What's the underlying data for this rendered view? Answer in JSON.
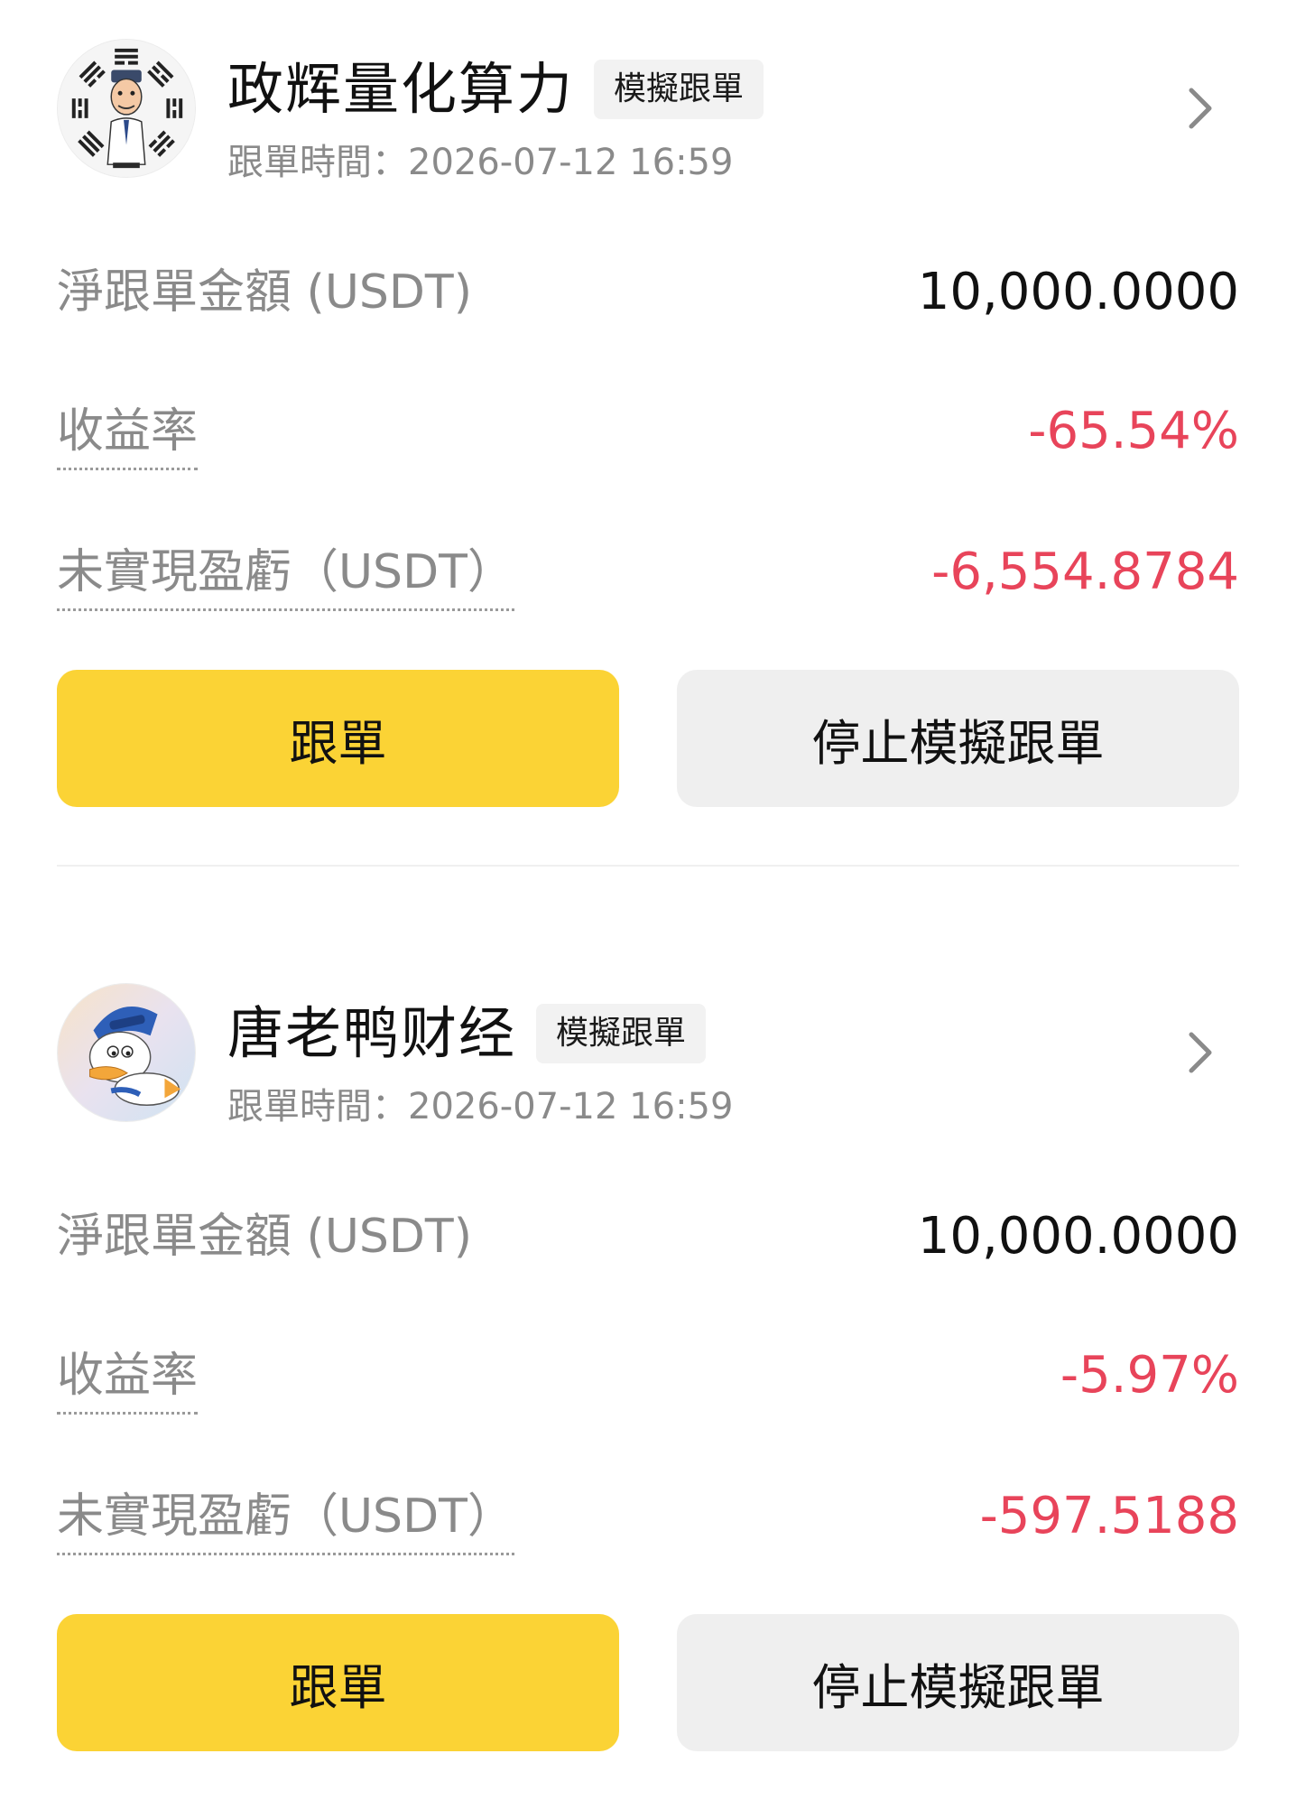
{
  "cards": [
    {
      "trader_name": "政辉量化算力",
      "tag": "模擬跟單",
      "follow_time": "跟單時間：2026-07-12 16:59",
      "avatar_icon": "bagua-cartoon-man-avatar",
      "net_amount_label": "淨跟單金額 (USDT)",
      "net_amount_value": "10,000.0000",
      "roi_label": "收益率",
      "roi_value": "-65.54%",
      "pnl_label": "未實現盈虧（USDT）",
      "pnl_value": "-6,554.8784",
      "follow_button": "跟單",
      "stop_button": "停止模擬跟單"
    },
    {
      "trader_name": "唐老鸭财经",
      "tag": "模擬跟單",
      "follow_time": "跟單時間：2026-07-12 16:59",
      "avatar_icon": "cartoon-duck-avatar",
      "net_amount_label": "淨跟單金額 (USDT)",
      "net_amount_value": "10,000.0000",
      "roi_label": "收益率",
      "roi_value": "-5.97%",
      "pnl_label": "未實現盈虧（USDT）",
      "pnl_value": "-597.5188",
      "follow_button": "跟單",
      "stop_button": "停止模擬跟單"
    }
  ],
  "colors": {
    "negative": "#e8445a",
    "primary_button": "#fbd335",
    "secondary_button": "#efefef",
    "label_gray": "#8a8a8a"
  }
}
